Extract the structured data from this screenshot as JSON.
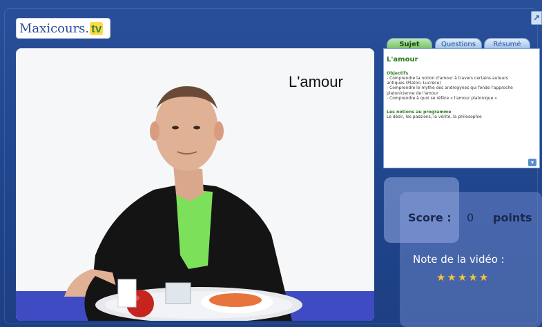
{
  "logo": {
    "main": "Maxicours.",
    "tv": "tv"
  },
  "corner": {
    "icon": "expand-icon"
  },
  "video": {
    "title": "L'amour"
  },
  "tabs": [
    {
      "label": "Sujet"
    },
    {
      "label": "Questions"
    },
    {
      "label": "Résumé"
    }
  ],
  "panel": {
    "title": "L'amour",
    "objectifs_head": "Objectifs",
    "objectifs_lines": [
      "- Comprendre la notion d'amour à travers certains auteurs",
      "antiques (Platon, Lucrèce)",
      "- Comprendre le mythe des androgynes qui fonde l'approche",
      "platonicienne de l'amour",
      "- Comprendre à quoi se réfère « l'amour platonique »"
    ],
    "notions_head": "Les notions au programme",
    "notions_text": "Le désir, les passions, la vérité, la philosophie"
  },
  "score": {
    "label": "Score :",
    "value": "0",
    "unit": "points"
  },
  "rating": {
    "label": "Note de la vidéo :",
    "stars": 5
  }
}
